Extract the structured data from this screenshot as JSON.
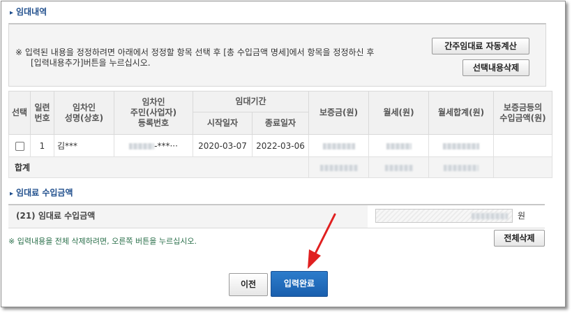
{
  "lease_section": {
    "title": "임대내역"
  },
  "notice": {
    "line1": "※ 입력된 내용을 정정하려면 아래에서 정정할 항목 선택 후 [총 수입금액 명세]에서 항목을 정정하신 후",
    "line2": "[입력내용추가]버튼을 누르십시오."
  },
  "buttons": {
    "auto_calc": "간주임대료 자동계산",
    "delete_selected": "선택내용삭제",
    "delete_all": "전체삭제",
    "prev": "이전",
    "complete": "입력완료"
  },
  "table": {
    "headers": {
      "select": "선택",
      "serial": "일련\n번호",
      "tenant_name": "임차인\n성명(상호)",
      "tenant_id": "임차인\n주민(사업자)\n등록번호",
      "period": "임대기간",
      "start": "시작일자",
      "end": "종료일자",
      "deposit": "보증금(원)",
      "monthly": "월세(원)",
      "monthly_total": "월세합계(원)",
      "deposit_income": "보증금등의\n수입금액(원)"
    },
    "rows": [
      {
        "serial": "1",
        "tenant_name": "김***",
        "tenant_id_suffix": "-***···",
        "start": "2020-03-07",
        "end": "2022-03-06"
      }
    ],
    "sum_label": "합계"
  },
  "income_section": {
    "title": "임대료 수입금액",
    "label": "(21) 임대료 수입금액",
    "unit": "원"
  },
  "hint": "※ 입력내용을 전체 삭제하려면, 오른쪽 버튼을 누르십시오.",
  "colors": {
    "title_blue": "#1f4e8c",
    "primary_button": "#1a64b4",
    "hint_green": "#2a6f4a",
    "arrow_red": "#e02020"
  }
}
